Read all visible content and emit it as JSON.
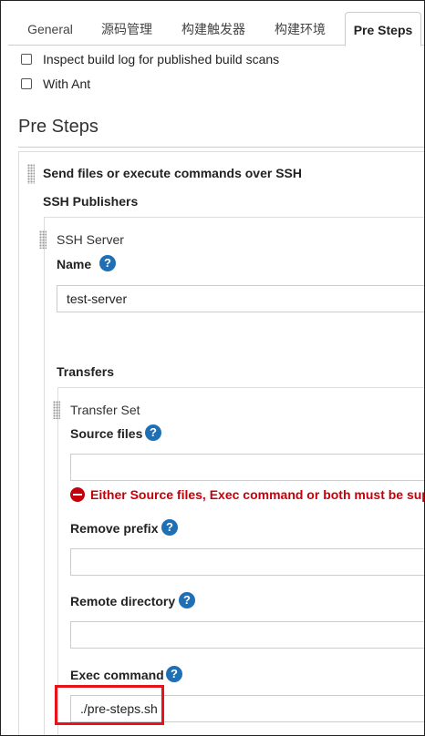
{
  "tabs": [
    {
      "label": "General"
    },
    {
      "label": "源码管理"
    },
    {
      "label": "构建触发器"
    },
    {
      "label": "构建环境"
    },
    {
      "label": "Pre Steps"
    }
  ],
  "options": {
    "inspect_build_log": "Inspect build log for published build scans",
    "with_ant": "With Ant"
  },
  "section": {
    "title": "Pre Steps"
  },
  "step": {
    "title": "Send files or execute commands over SSH",
    "publishers_label": "SSH Publishers",
    "server": {
      "header": "SSH Server",
      "name_label": "Name",
      "name_value": "test-server",
      "transfers_label": "Transfers",
      "transfer_set": {
        "header": "Transfer Set",
        "source_files_label": "Source files",
        "source_files_value": "",
        "error_message": "Either Source files, Exec command or both must be supp",
        "remove_prefix_label": "Remove prefix",
        "remove_prefix_value": "",
        "remote_directory_label": "Remote directory",
        "remote_directory_value": "",
        "exec_command_label": "Exec command",
        "exec_command_value": "./pre-steps.sh"
      }
    }
  },
  "help_icon_glyph": "?",
  "colors": {
    "help": "#1f6fb5",
    "error": "#c4000a",
    "highlight": "#e8121b"
  }
}
